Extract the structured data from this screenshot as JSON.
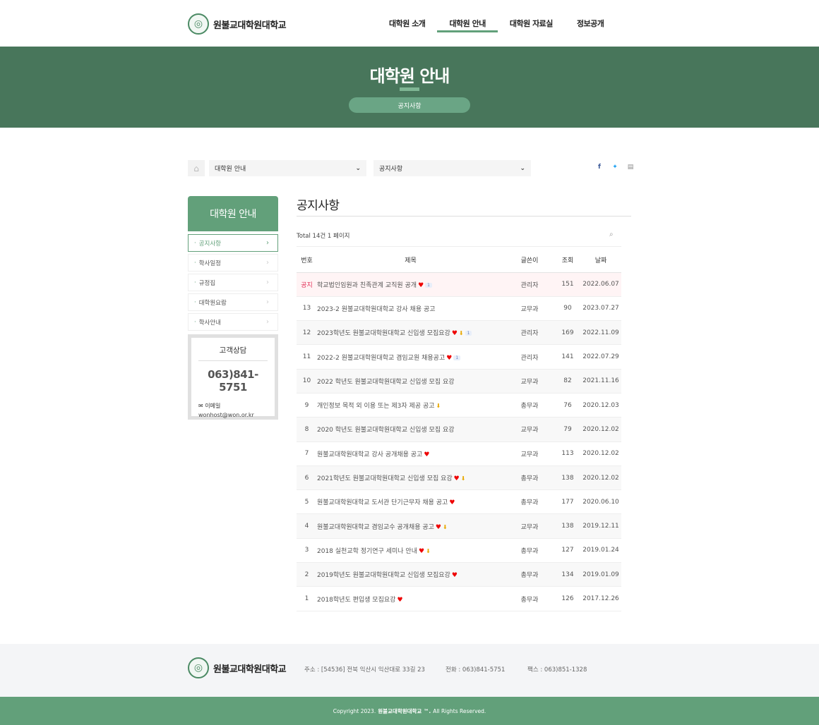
{
  "header": {
    "logo_text": "원불교대학원대학교",
    "nav": [
      "대학원 소개",
      "대학원 안내",
      "대학원 자료실",
      "정보공개"
    ]
  },
  "banner": {
    "title": "대학원 안내",
    "sub": "공지사항"
  },
  "location": {
    "select1": "대학원 안내",
    "select2": "공지사항"
  },
  "sidebar": {
    "title": "대학원 안내",
    "items": [
      "공지사항",
      "학사일정",
      "규정집",
      "대학원요람",
      "학사안내"
    ],
    "cs_title": "고객상담",
    "cs_phone": "063)841-5751",
    "cs_mail_label": "이메일",
    "cs_mail": "wonhost@won.or.kr"
  },
  "board": {
    "title": "공지사항",
    "total": "Total 14건 1 페이지",
    "headers": {
      "num": "번호",
      "subject": "제목",
      "writer": "글쓴이",
      "hit": "조회",
      "date": "날짜"
    },
    "rows": [
      {
        "num": "공지",
        "subject": "학교법인임원과 친족관계 교직원 공개",
        "heart": true,
        "file": false,
        "cmt": "1",
        "writer": "관리자",
        "hit": "151",
        "date": "2022.06.07"
      },
      {
        "num": "13",
        "subject": "2023-2 원불교대학원대학교 강사 채용 공고",
        "heart": false,
        "file": false,
        "cmt": "",
        "writer": "교무과",
        "hit": "90",
        "date": "2023.07.27"
      },
      {
        "num": "12",
        "subject": "2023학년도 원불교대학원대학교 신입생 모집요강",
        "heart": true,
        "file": true,
        "cmt": "1",
        "writer": "관리자",
        "hit": "169",
        "date": "2022.11.09"
      },
      {
        "num": "11",
        "subject": "2022-2 원불교대학원대학교 겸임교원 채용공고",
        "heart": true,
        "file": false,
        "cmt": "1",
        "writer": "관리자",
        "hit": "141",
        "date": "2022.07.29"
      },
      {
        "num": "10",
        "subject": "2022 학년도 원불교대학원대학교 신입생 모집 요강",
        "heart": false,
        "file": false,
        "cmt": "",
        "writer": "교무과",
        "hit": "82",
        "date": "2021.11.16"
      },
      {
        "num": "9",
        "subject": "개인정보 목적 외 이용 또는 제3자 제공 공고",
        "heart": false,
        "file": true,
        "cmt": "",
        "writer": "총무과",
        "hit": "76",
        "date": "2020.12.03"
      },
      {
        "num": "8",
        "subject": "2020 학년도 원불교대학원대학교 신입생 모집 요강",
        "heart": false,
        "file": false,
        "cmt": "",
        "writer": "교무과",
        "hit": "79",
        "date": "2020.12.02"
      },
      {
        "num": "7",
        "subject": "원불교대학원대학교 강사 공개채용 공고",
        "heart": true,
        "file": false,
        "cmt": "",
        "writer": "교무과",
        "hit": "113",
        "date": "2020.12.02"
      },
      {
        "num": "6",
        "subject": "2021학년도 원불교대학원대학교 신입생 모집 요강",
        "heart": true,
        "file": true,
        "cmt": "",
        "writer": "총무과",
        "hit": "138",
        "date": "2020.12.02"
      },
      {
        "num": "5",
        "subject": "원불교대학원대학교 도서관 단기근무자 채용 공고",
        "heart": true,
        "file": false,
        "cmt": "",
        "writer": "총무과",
        "hit": "177",
        "date": "2020.06.10"
      },
      {
        "num": "4",
        "subject": "원불교대학원대학교 겸임교수 공개채용 공고",
        "heart": true,
        "file": true,
        "cmt": "",
        "writer": "교무과",
        "hit": "138",
        "date": "2019.12.11"
      },
      {
        "num": "3",
        "subject": "2018 실천교학 정기연구 세미나 안내",
        "heart": true,
        "file": true,
        "cmt": "",
        "writer": "총무과",
        "hit": "127",
        "date": "2019.01.24"
      },
      {
        "num": "2",
        "subject": "2019학년도 원불교대학원대학교 신입생 모집요강",
        "heart": true,
        "file": false,
        "cmt": "",
        "writer": "총무과",
        "hit": "134",
        "date": "2019.01.09"
      },
      {
        "num": "1",
        "subject": "2018학년도 편입생 모집요강",
        "heart": true,
        "file": false,
        "cmt": "",
        "writer": "총무과",
        "hit": "126",
        "date": "2017.12.26"
      }
    ]
  },
  "footer": {
    "logo_text": "원불교대학원대학교",
    "address": "주소 : [54536] 전북 익산시 익산대로 33길 23",
    "phone": "전화 : 063)841-5751",
    "fax": "팩스 : 063)851-1328",
    "copy_pre": "Copyright 2023.",
    "copy_name": "원불교대학원대학교 ™.",
    "copy_post": "All Rights Reserved."
  },
  "colors": {
    "brand": "#62a07a",
    "banner": "#48765b",
    "notice": "#e2335a"
  }
}
